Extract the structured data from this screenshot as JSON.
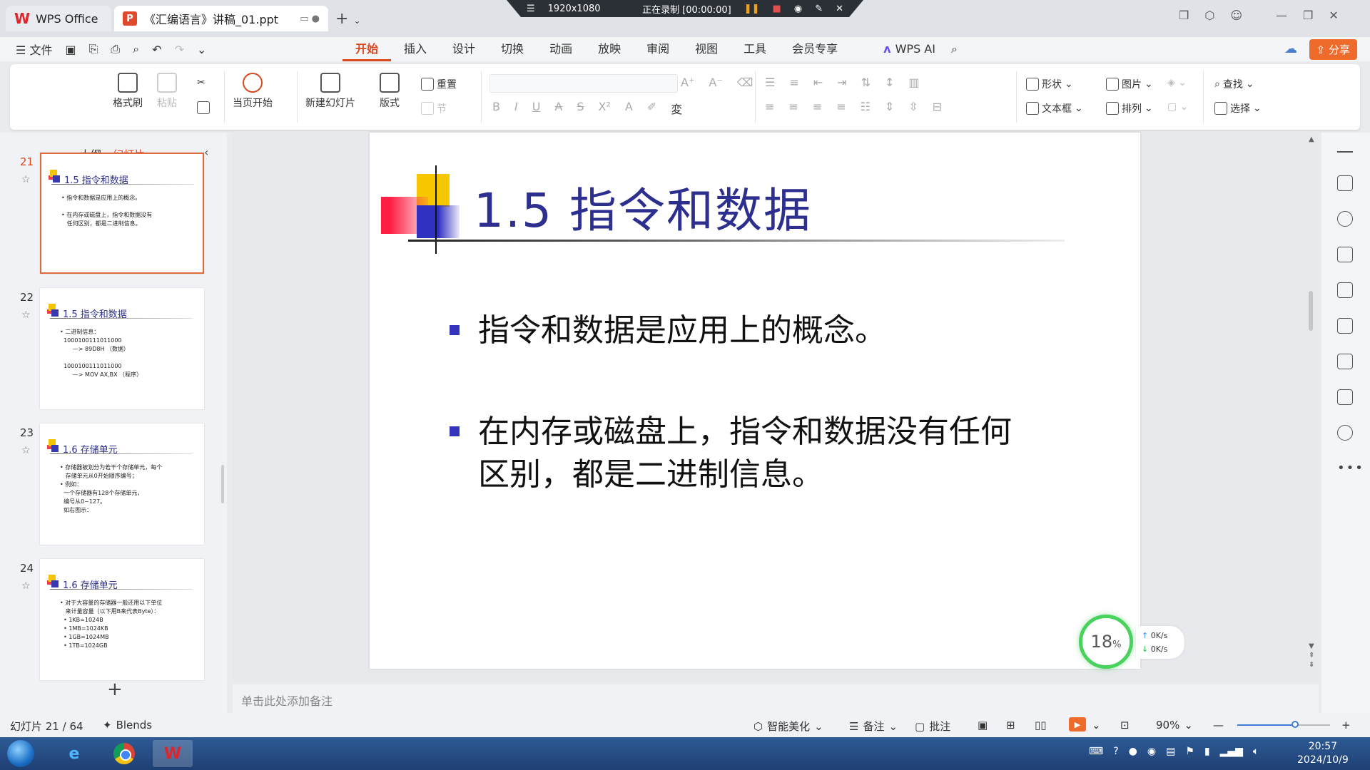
{
  "titlebar": {
    "app_tab": "WPS Office",
    "doc_tab": "《汇编语言》讲稿_01.ppt",
    "recorder": {
      "resolution": "1920x1080",
      "status": "正在录制 [00:00:00]"
    }
  },
  "menubar": {
    "file": "文件",
    "tabs": [
      "开始",
      "插入",
      "设计",
      "切换",
      "动画",
      "放映",
      "审阅",
      "视图",
      "工具",
      "会员专享"
    ],
    "active_tab": "开始",
    "wps_ai": "WPS AI",
    "share": "分享"
  },
  "ribbon": {
    "format_painter": "格式刷",
    "paste": "粘贴",
    "play_from_current": "当页开始",
    "new_slide": "新建幻灯片",
    "layout": "版式",
    "reset": "重置",
    "section": "节",
    "shape": "形状",
    "picture": "图片",
    "textbox": "文本框",
    "arrange": "排列",
    "find": "查找",
    "select": "选择"
  },
  "leftpanel": {
    "tab_outline": "大纲",
    "tab_slides": "幻灯片",
    "thumbs": [
      {
        "num": "21",
        "title": "1.5 指令和数据",
        "body": "• 指令和数据是应用上的概念。\n\n• 在内存或磁盘上，指令和数据没有\n   任何区别，都是二进制信息。"
      },
      {
        "num": "22",
        "title": "1.5 指令和数据",
        "body": "• 二进制信息：\n  1000100111011000\n       —> 89D8H （数据）\n\n  1000100111011000\n       —> MOV AX,BX （程序）"
      },
      {
        "num": "23",
        "title": "1.6 存储单元",
        "body": "• 存储器被划分为若干个存储单元，每个\n   存储单元从0开始顺序编号；\n• 例如：\n  一个存储器有128个存储单元，\n  编号从0~127。\n  如右图示："
      },
      {
        "num": "24",
        "title": "1.6 存储单元",
        "body": "• 对于大容量的存储器一般还用以下单位\n   来计量容量（以下用B来代表Byte）：\n  • 1KB=1024B\n  • 1MB=1024KB\n  • 1GB=1024MB\n  • 1TB=1024GB"
      }
    ]
  },
  "slide": {
    "title": "1.5 指令和数据",
    "bullets": [
      "指令和数据是应用上的概念。",
      "在内存或磁盘上，指令和数据没有任何区别，都是二进制信息。"
    ]
  },
  "notes_placeholder": "单击此处添加备注",
  "perf": {
    "cpu": "18",
    "unit": "%",
    "up": "0K/s",
    "down": "0K/s"
  },
  "statusbar": {
    "slide_counter": "幻灯片 21 / 64",
    "theme": "Blends",
    "beautify": "智能美化",
    "notes": "备注",
    "comments": "批注",
    "zoom": "90%",
    "zoom_level": 0.62
  },
  "taskbar": {
    "time": "20:57",
    "date": "2024/10/9"
  }
}
